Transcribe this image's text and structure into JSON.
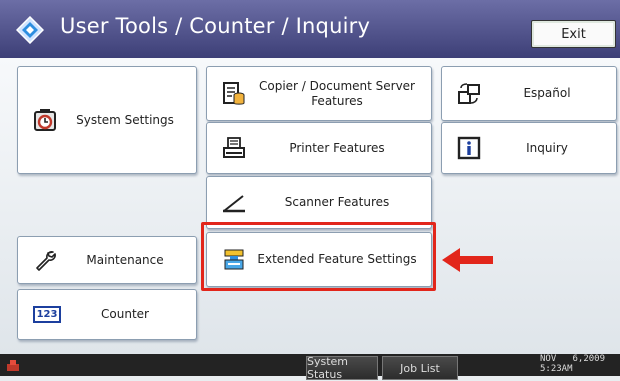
{
  "header": {
    "title": "User Tools / Counter / Inquiry",
    "exit_label": "Exit",
    "accent_color": "#4b4d88"
  },
  "tiles": {
    "system_settings": "System Settings",
    "copier": "Copier / Document Server Features",
    "printer": "Printer Features",
    "scanner": "Scanner Features",
    "extended": "Extended Feature Settings",
    "espanol": "Español",
    "inquiry": "Inquiry",
    "maintenance": "Maintenance",
    "counter": "Counter",
    "counter_icon_text": "123"
  },
  "icons": [
    "alarm-clock-icon",
    "copier-icon",
    "printer-icon",
    "scanner-icon",
    "extended-feature-icon",
    "language-switch-icon",
    "info-icon",
    "wrench-icon",
    "counter-icon"
  ],
  "annotation_color": "#e2261b",
  "statusbar": {
    "system_status_label": "System Status",
    "job_list_label": "Job List",
    "date_line1": "NOV   6,2009",
    "date_line2": "5:23AM"
  }
}
